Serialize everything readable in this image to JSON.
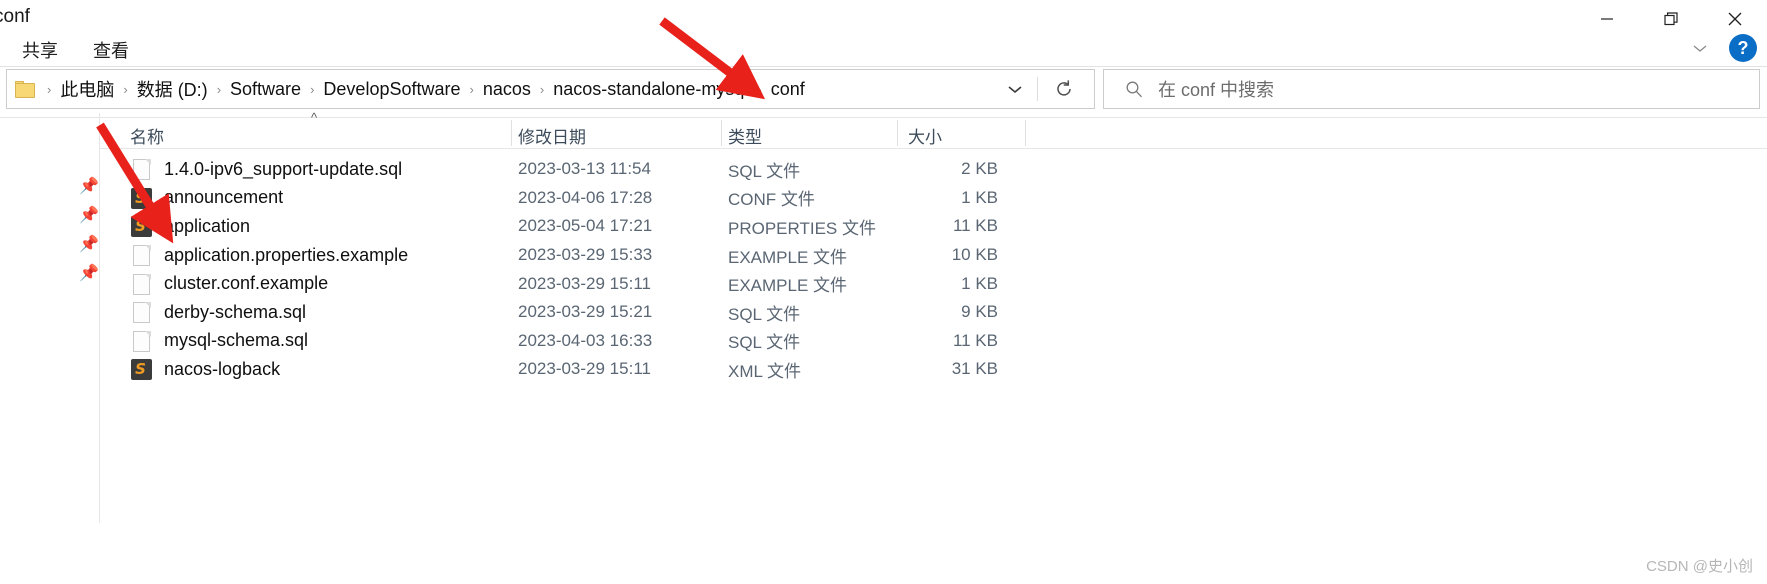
{
  "window": {
    "title": "conf",
    "controls": {
      "minimize": "minimize-icon",
      "restore": "restore-icon",
      "close": "close-icon"
    }
  },
  "menubar": {
    "items": [
      {
        "label": "共享",
        "name": "menu-share"
      },
      {
        "label": "查看",
        "name": "menu-view"
      }
    ],
    "expand_ribbon": "chevron-down-icon",
    "help": "?"
  },
  "address": {
    "folder_icon": "folder-icon",
    "crumbs": [
      "此电脑",
      "数据 (D:)",
      "Software",
      "DevelopSoftware",
      "nacos",
      "nacos-standalone-mysql",
      "conf"
    ],
    "separator": "›",
    "dropdown_icon": "chevron-down-icon",
    "refresh_icon": "refresh-icon"
  },
  "search": {
    "icon": "search-icon",
    "placeholder": "在 conf 中搜索",
    "value": ""
  },
  "columns": {
    "name": "名称",
    "date": "修改日期",
    "type": "类型",
    "size": "大小",
    "sort_caret": "^",
    "sorted_by": "名称"
  },
  "files": [
    {
      "name": "1.4.0-ipv6_support-update.sql",
      "date": "2023-03-13 11:54",
      "type": "SQL 文件",
      "size": "2 KB",
      "icon": "document-icon"
    },
    {
      "name": "announcement",
      "date": "2023-04-06 17:28",
      "type": "CONF 文件",
      "size": "1 KB",
      "icon": "sublime-text-icon"
    },
    {
      "name": "application",
      "date": "2023-05-04 17:21",
      "type": "PROPERTIES 文件",
      "size": "11 KB",
      "icon": "sublime-text-icon"
    },
    {
      "name": "application.properties.example",
      "date": "2023-03-29 15:33",
      "type": "EXAMPLE 文件",
      "size": "10 KB",
      "icon": "document-icon"
    },
    {
      "name": "cluster.conf.example",
      "date": "2023-03-29 15:11",
      "type": "EXAMPLE 文件",
      "size": "1 KB",
      "icon": "document-icon"
    },
    {
      "name": "derby-schema.sql",
      "date": "2023-03-29 15:21",
      "type": "SQL 文件",
      "size": "9 KB",
      "icon": "document-icon"
    },
    {
      "name": "mysql-schema.sql",
      "date": "2023-04-03 16:33",
      "type": "SQL 文件",
      "size": "11 KB",
      "icon": "document-icon"
    },
    {
      "name": "nacos-logback",
      "date": "2023-03-29 15:11",
      "type": "XML 文件",
      "size": "31 KB",
      "icon": "sublime-text-icon"
    }
  ],
  "annotations": {
    "arrow_color": "#e8211b",
    "arrow_targets": [
      "conf-breadcrumb",
      "application-file-row"
    ]
  },
  "watermark": "CSDN @史小创"
}
